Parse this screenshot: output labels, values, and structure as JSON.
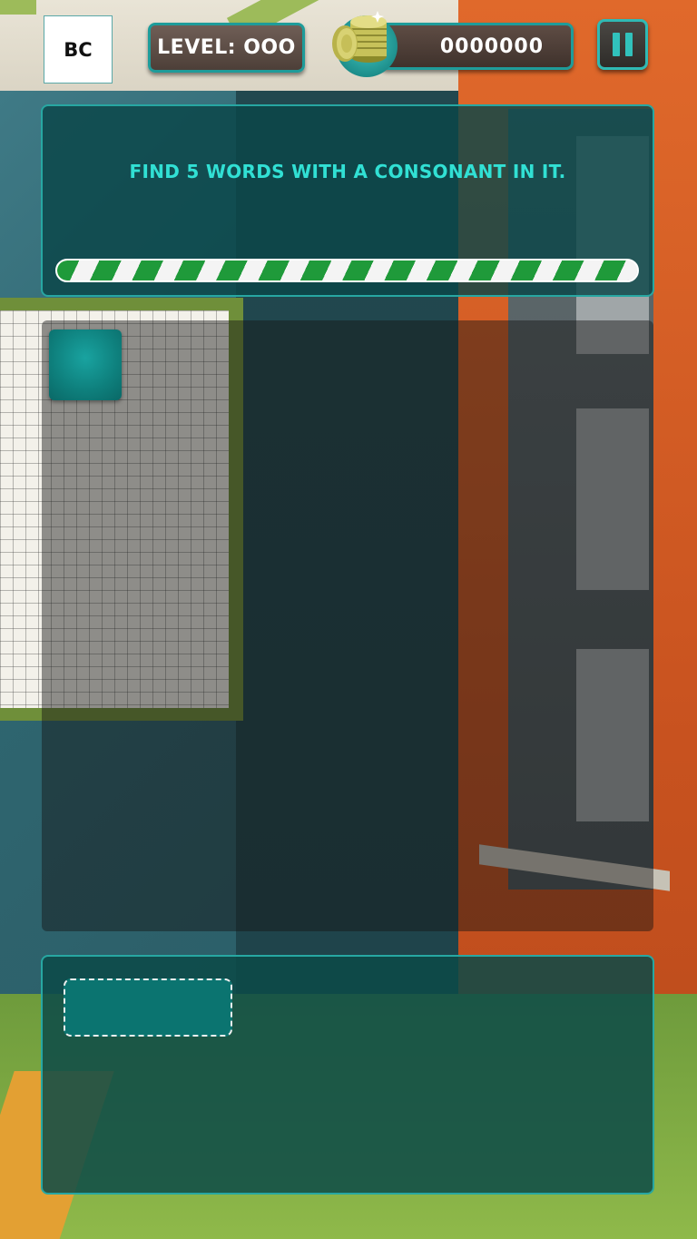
{
  "hud": {
    "badge_text": "BC",
    "level_text": "LEVEL: OOO",
    "coins_text": "0000000",
    "coin_icon": "coin-stack-icon",
    "pause_icon": "pause-icon"
  },
  "question": {
    "prompt": "FIND 5 WORDS WITH A CONSONANT IN IT.",
    "progress": 1.0
  },
  "board": {
    "tiles": [
      {
        "letter": ""
      }
    ]
  },
  "answers": {
    "slots": [
      {
        "text": ""
      }
    ]
  },
  "colors": {
    "accent_teal": "#31e0d4",
    "panel_border": "#27a7a2",
    "progress_green": "#1f9a3a",
    "wall_orange": "#e0692b"
  }
}
